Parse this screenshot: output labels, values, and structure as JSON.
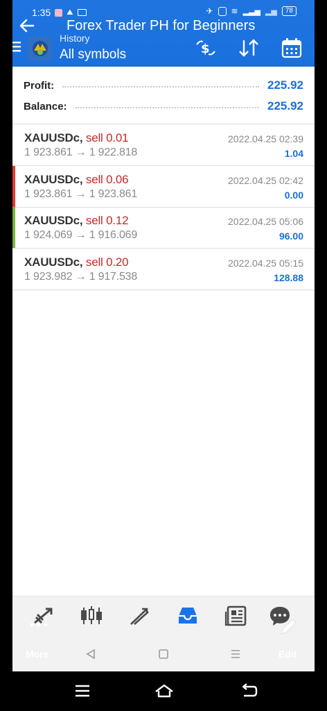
{
  "status_bar": {
    "time": "1:35",
    "battery": "78"
  },
  "app_title": "Forex Trader PH for Beginners",
  "header": {
    "section": "History",
    "filter": "All symbols"
  },
  "summary": {
    "profit_label": "Profit:",
    "profit_value": "225.92",
    "balance_label": "Balance:",
    "balance_value": "225.92"
  },
  "trades": [
    {
      "symbol": "XAUUSDc,",
      "side": "sell 0.01",
      "open": "1 923.861",
      "arrow": "→",
      "close": "1 922.818",
      "time": "2022.04.25 02:39",
      "profit": "1.04",
      "bar_color": ""
    },
    {
      "symbol": "XAUUSDc,",
      "side": "sell 0.06",
      "open": "1 923.861",
      "arrow": "→",
      "close": "1 923.861",
      "time": "2022.04.25 02:42",
      "profit": "0.00",
      "bar_color": "#e53935"
    },
    {
      "symbol": "XAUUSDc,",
      "side": "sell 0.12",
      "open": "1 924.069",
      "arrow": "→",
      "close": "1 916.069",
      "time": "2022.04.25 05:06",
      "profit": "96.00",
      "bar_color": "#7cb342"
    },
    {
      "symbol": "XAUUSDc,",
      "side": "sell 0.20",
      "open": "1 923.982",
      "arrow": "→",
      "close": "1 917.538",
      "time": "2022.04.25 05:15",
      "profit": "128.88",
      "bar_color": ""
    }
  ],
  "bottom_nav": {
    "more_label": "More",
    "edit_label": "Edit",
    "active_tab": "history"
  },
  "colors": {
    "accent": "#1a73e8",
    "profit_text": "#1b6fd6",
    "sell_text": "#c62828"
  }
}
